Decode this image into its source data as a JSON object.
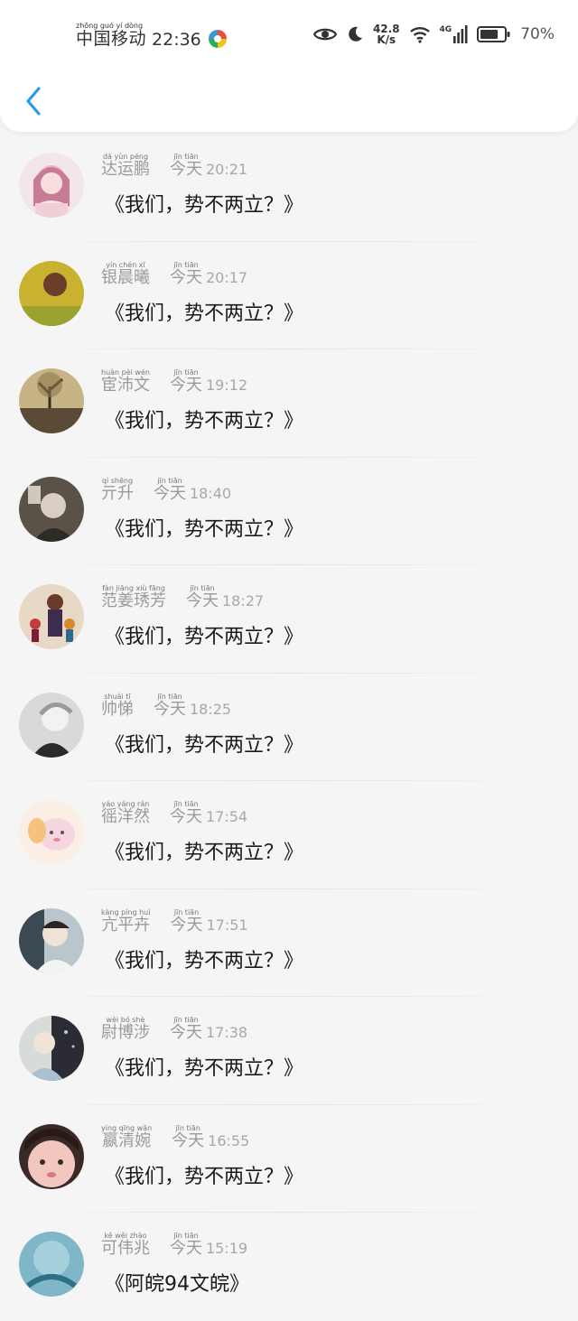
{
  "status_bar": {
    "carrier_pinyin": "zhōng guó  yí  dòng",
    "carrier": "中国移动",
    "time": "22:36",
    "net_speed_value": "42.8",
    "net_speed_unit": "K/s",
    "network": "4G",
    "battery": "70%"
  },
  "colors": {
    "accent": "#2b9be6",
    "name_text": "#9a9a9a",
    "message_text": "#1a1a1a"
  },
  "messages": [
    {
      "pinyin": "dá yùn péng",
      "name": "达运鹏",
      "time_pinyin": "jīn tiān",
      "time_word": "今天",
      "time": "20:21",
      "message": "《我们，势不两立？》"
    },
    {
      "pinyin": "yín chén xī",
      "name": "银晨曦",
      "time_pinyin": "jīn tiān",
      "time_word": "今天",
      "time": "20:17",
      "message": "《我们，势不两立？》"
    },
    {
      "pinyin": "huàn pèi wén",
      "name": "宦沛文",
      "time_pinyin": "jīn tiān",
      "time_word": "今天",
      "time": "19:12",
      "message": "《我们，势不两立？》"
    },
    {
      "pinyin": "qí shēng",
      "name": "亓升",
      "time_pinyin": "jīn tiān",
      "time_word": "今天",
      "time": "18:40",
      "message": "《我们，势不两立？》"
    },
    {
      "pinyin": "fàn jiāng xiù fāng",
      "name": "范姜琇芳",
      "time_pinyin": "jīn tiān",
      "time_word": "今天",
      "time": "18:27",
      "message": "《我们，势不两立？》"
    },
    {
      "pinyin": "shuài tī",
      "name": "帅悌",
      "time_pinyin": "jīn tiān",
      "time_word": "今天",
      "time": "18:25",
      "message": "《我们，势不两立？》"
    },
    {
      "pinyin": "yáo yáng rán",
      "name": "徭洋然",
      "time_pinyin": "jīn tiān",
      "time_word": "今天",
      "time": "17:54",
      "message": "《我们，势不两立？》"
    },
    {
      "pinyin": "kàng píng huì",
      "name": "亢平卉",
      "time_pinyin": "jīn tiān",
      "time_word": "今天",
      "time": "17:51",
      "message": "《我们，势不两立？》"
    },
    {
      "pinyin": "wèi bó shè",
      "name": "尉博涉",
      "time_pinyin": "jīn tiān",
      "time_word": "今天",
      "time": "17:38",
      "message": "《我们，势不两立？》"
    },
    {
      "pinyin": "yíng qīng wǎn",
      "name": "嬴清婉",
      "time_pinyin": "jīn tiān",
      "time_word": "今天",
      "time": "16:55",
      "message": "《我们，势不两立？》"
    },
    {
      "pinyin": "kě wěi zhào",
      "name": "可伟兆",
      "time_pinyin": "jīn tiān",
      "time_word": "今天",
      "time": "15:19",
      "message": "《阿皖94文皖》"
    }
  ]
}
